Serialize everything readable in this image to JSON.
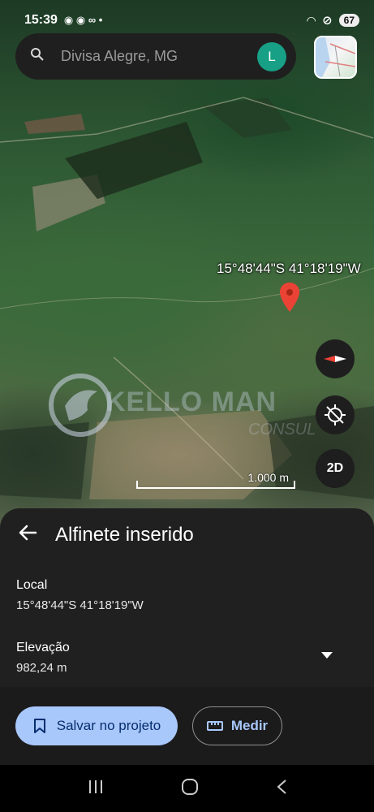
{
  "status_bar": {
    "time": "15:39",
    "battery": "67"
  },
  "search": {
    "placeholder": "Divisa Alegre, MG",
    "avatar_letter": "L"
  },
  "map": {
    "pin_coordinates": "15°48'44\"S 41°18'19\"W",
    "tilt_button": "2D",
    "scale": "1.000 m",
    "watermark_text": "KELLO MAN",
    "watermark_sub": "CONSUL"
  },
  "sheet": {
    "title": "Alfinete inserido",
    "location_label": "Local",
    "location_value": "15°48'44\"S 41°18'19\"W",
    "elevation_label": "Elevação",
    "elevation_value": "982,24 m",
    "save_button": "Salvar no projeto",
    "measure_button": "Medir"
  }
}
